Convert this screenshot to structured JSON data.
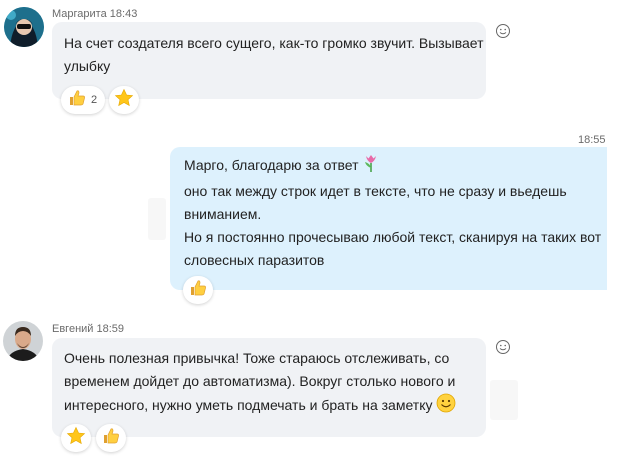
{
  "messages": [
    {
      "author": "Маргарита",
      "time": "18:43",
      "lines": [
        "На счет создателя всего сущего, как-то громко звучит. Вызывает",
        "улыбку"
      ],
      "reactions": [
        {
          "icon": "thumbs-up-icon",
          "count": "2"
        },
        {
          "icon": "star-icon",
          "count": ""
        }
      ]
    },
    {
      "time": "18:55",
      "lines": [
        "Марго, благодарю за ответ",
        "оно так между строк идет в тексте, что не сразу и вьедешь",
        "вниманием.",
        "Но я постоянно прочесываю любой текст, сканируя на таких вот",
        "словесных паразитов"
      ],
      "reactions": [
        {
          "icon": "thumbs-up-icon",
          "count": ""
        }
      ]
    },
    {
      "author": "Евгений",
      "time": "18:59",
      "lines": [
        "Очень полезная привычка! Тоже стараюсь отслеживать, со",
        "временем дойдет до автоматизма). Вокруг столько нового и",
        "интересного, нужно уметь подмечать и брать на заметку"
      ],
      "reactions": [
        {
          "icon": "star-icon",
          "count": ""
        },
        {
          "icon": "thumbs-up-icon",
          "count": ""
        }
      ]
    }
  ],
  "colors": {
    "incoming_bubble": "#f0f2f5",
    "outgoing_bubble": "#ddf1fd",
    "meta_text": "#6b6b6b"
  }
}
